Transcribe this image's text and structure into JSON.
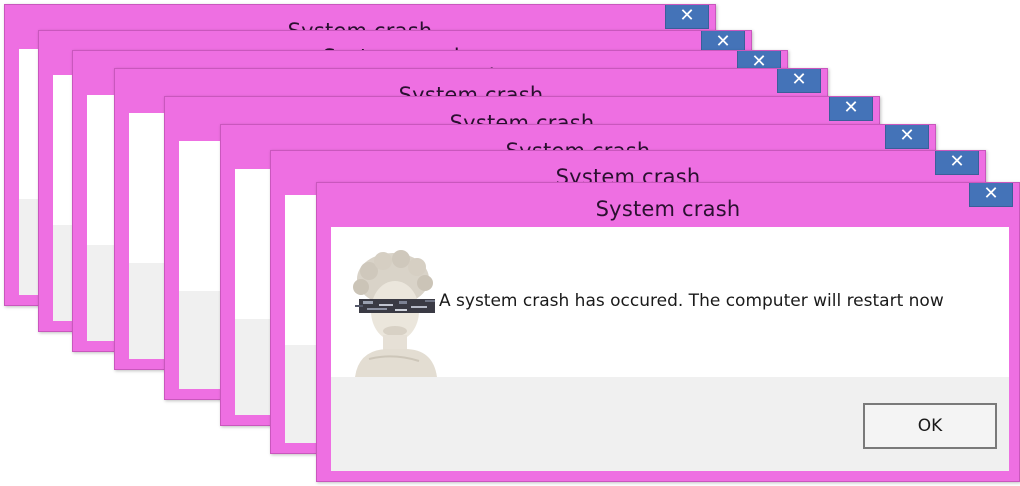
{
  "dialog": {
    "title": "System crash",
    "close_label": "✕",
    "message": "A system crash has occured. The computer will restart now",
    "ok_label": "OK"
  },
  "colors": {
    "titlebar": "#ee6fe2",
    "close_button": "#4473b8",
    "button_area": "#f0f0f0"
  },
  "icons": {
    "close": "close-icon",
    "dialog_image": "glitched-statue-image"
  }
}
